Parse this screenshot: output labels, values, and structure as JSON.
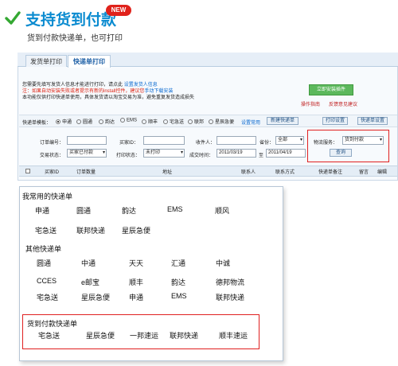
{
  "header": {
    "title": "支持货到付款",
    "badge": "NEW",
    "subtitle": "货到付款快递单，也可打印"
  },
  "tabs": [
    {
      "label": "发货单打印"
    },
    {
      "label": "快递单打印"
    }
  ],
  "notice": {
    "line1": "您需要先填写发货人信息才能进行打印，请点此",
    "line1_link": "设置发货人信息",
    "line2": "注：如果自动安装失败或者提示有新的install控件，建议您",
    "line2_link": "手动下载安装",
    "line3": "本功能仅供打印快递单使用，具体发货请以淘宝交易为准，避免重复发货造成损失"
  },
  "side": {
    "install_btn": "立即安装插件",
    "guide": "操作指南",
    "feedback": "反馈意见建议"
  },
  "template_row": {
    "label": "快递单模板：",
    "options": [
      "申通",
      "圆通",
      "韵达",
      "EMS",
      "顺丰",
      "宅急送",
      "联邦",
      "星辰急便"
    ],
    "selected": "申通",
    "setup_link": "设置常用",
    "btn_new": "新建快递单",
    "btn_print_settings": "打印设置",
    "btn_template_settings": "快递单设置"
  },
  "filters": {
    "order_no": "订单编号：",
    "buyer_id": "买家ID：",
    "receiver": "收件人：",
    "province": "省份：",
    "province_value": "全部",
    "logistics": "物流服务：",
    "logistics_value": "货到付款",
    "trade_status": "交易状态：",
    "trade_status_value": "买家已付款",
    "print_status": "打印状态：",
    "print_status_value": "未打印",
    "deal_time": "成交时间：",
    "date_from": "2011/03/19",
    "date_sep": "至",
    "date_to": "2011/04/19",
    "query_btn": "查询"
  },
  "table_header": [
    "买家ID",
    "订单数量",
    "地址",
    "联系人",
    "联系方式",
    "快递单备注",
    "留言",
    "编辑"
  ],
  "express": {
    "common_title": "我常用的快递单",
    "common": [
      "申通",
      "圆通",
      "韵达",
      "EMS",
      "顺风",
      "宅急送",
      "联邦快递",
      "星辰急便"
    ],
    "other_title": "其他快递单",
    "other": [
      "圆通",
      "中通",
      "天天",
      "汇通",
      "中诚",
      "CCES",
      "e邮宝",
      "顺丰",
      "韵达",
      "德邦物流",
      "宅急送",
      "星辰急便",
      "申通",
      "EMS",
      "联邦快递"
    ],
    "cod_title": "货到付款快递单",
    "cod": [
      "宅急送",
      "星辰急便",
      "一邦速运",
      "联邦快递",
      "顺丰速运"
    ]
  },
  "colors": {
    "title": "#0a8bd0",
    "badge": "#e0221b",
    "highlight_box": "#e02020",
    "check": "#34a832"
  }
}
